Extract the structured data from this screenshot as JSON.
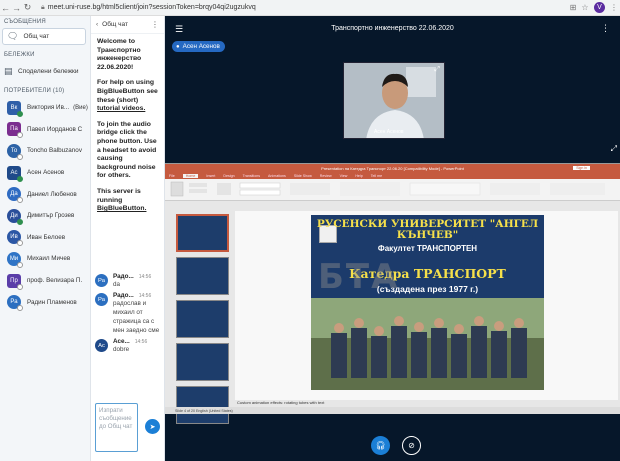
{
  "browser": {
    "url": "meet.uni-ruse.bg/html5client/join?sessionToken=brqy04qi2ugzukvq",
    "profile_initial": "V"
  },
  "left_panel": {
    "messages_title": "СЪОБЩЕНИЯ",
    "public_chat": "Общ чат",
    "notes_title": "БЕЛЕЖКИ",
    "shared_notes": "Споделени бележки",
    "users_title": "ПОТРЕБИТЕЛИ (10)",
    "users": [
      {
        "initials": "Вк",
        "name": "Виктория Ив...",
        "role": "(Вие)",
        "color": "#2f5fa8",
        "mod": true,
        "mic": true
      },
      {
        "initials": "Па",
        "name": "Павел Йорданов С...",
        "role": "",
        "color": "#7b2d8f",
        "mod": true,
        "mic": false
      },
      {
        "initials": "To",
        "name": "Toncho Balbuzanov",
        "role": "",
        "color": "#2c62a6",
        "mod": false,
        "mic": false
      },
      {
        "initials": "Ас",
        "name": "Асен Асенов",
        "role": "",
        "color": "#1f4a8a",
        "mod": true,
        "mic": true
      },
      {
        "initials": "Да",
        "name": "Даниел Любенов",
        "role": "",
        "color": "#2e6bc2",
        "mod": false,
        "mic": false
      },
      {
        "initials": "Ди",
        "name": "Димитър Грозев",
        "role": "",
        "color": "#2a4f9a",
        "mod": false,
        "mic": true
      },
      {
        "initials": "Ив",
        "name": "Иван Белоев",
        "role": "",
        "color": "#2b57a5",
        "mod": false,
        "mic": false
      },
      {
        "initials": "Ми",
        "name": "Михаил Мичев",
        "role": "",
        "color": "#2f74c6",
        "mod": false,
        "mic": false
      },
      {
        "initials": "Пр",
        "name": "проф. Велизара П...",
        "role": "",
        "color": "#5a3da8",
        "mod": true,
        "mic": false
      },
      {
        "initials": "Ра",
        "name": "Радин Пламенов",
        "role": "",
        "color": "#2c6fc0",
        "mod": false,
        "mic": false
      }
    ]
  },
  "chat": {
    "title": "Общ чат",
    "back_icon": "chevron-left-icon",
    "welcome": {
      "line1": "Welcome to",
      "line2": "Транспортно инженерство 22.06.2020!",
      "help": "For help on using BigBlueButton see these (short)",
      "tutorial_link": "tutorial videos.",
      "audio": "To join the audio bridge click the phone button. Use a headset to avoid causing background noise for others.",
      "server": "This server is running",
      "server_link": "BigBlueButton."
    },
    "messages": [
      {
        "initials": "Ра",
        "name": "Радо...",
        "time": "14:56",
        "text": "da",
        "color": "#2c6fc0"
      },
      {
        "initials": "Ра",
        "name": "Радо...",
        "time": "14:56",
        "text": "радослав и михаил от стражица са с мен заедно сме",
        "color": "#2c6fc0"
      },
      {
        "initials": "Ас",
        "name": "Асе...",
        "time": "14:56",
        "text": "dobre",
        "color": "#1f4a8a"
      }
    ],
    "input_placeholder": "Изпрати съобщение до Общ чат"
  },
  "main": {
    "title": "Транспортно инженерство 22.06.2020",
    "presenter": "Асен Асенов",
    "webcam_name": "Асен Асенов"
  },
  "ppt": {
    "window_title": "Presentation на Катедра Транспорт 22.06.20 [Compatibility Mode] - PowerPoint",
    "sign_in": "Sign in",
    "tabs": [
      "File",
      "Home",
      "Insert",
      "Design",
      "Transitions",
      "Animations",
      "Slide Show",
      "Review",
      "View",
      "Help",
      "Tell me"
    ],
    "active_tab": "Home",
    "notes": "Custom animation effects: rotating tubes with text",
    "status": "Slide 4 of 20   English (United States)",
    "slide": {
      "university": "РУСЕНСКИ УНИВЕРСИТЕТ \"АНГЕЛ КЪНЧЕВ\"",
      "faculty": "Факултет   ТРАНСПОРТЕН",
      "department": "Катедра  ТРАНСПОРТ",
      "since": "(създадена през 1977 г.)"
    },
    "watermark": "БТА"
  },
  "colors": {
    "main_bg": "#06172a",
    "accent": "#1b7fd6",
    "ppt_red": "#c55a3f",
    "slide_bg": "#1c3b6b",
    "slide_yellow": "#f6e04a"
  }
}
